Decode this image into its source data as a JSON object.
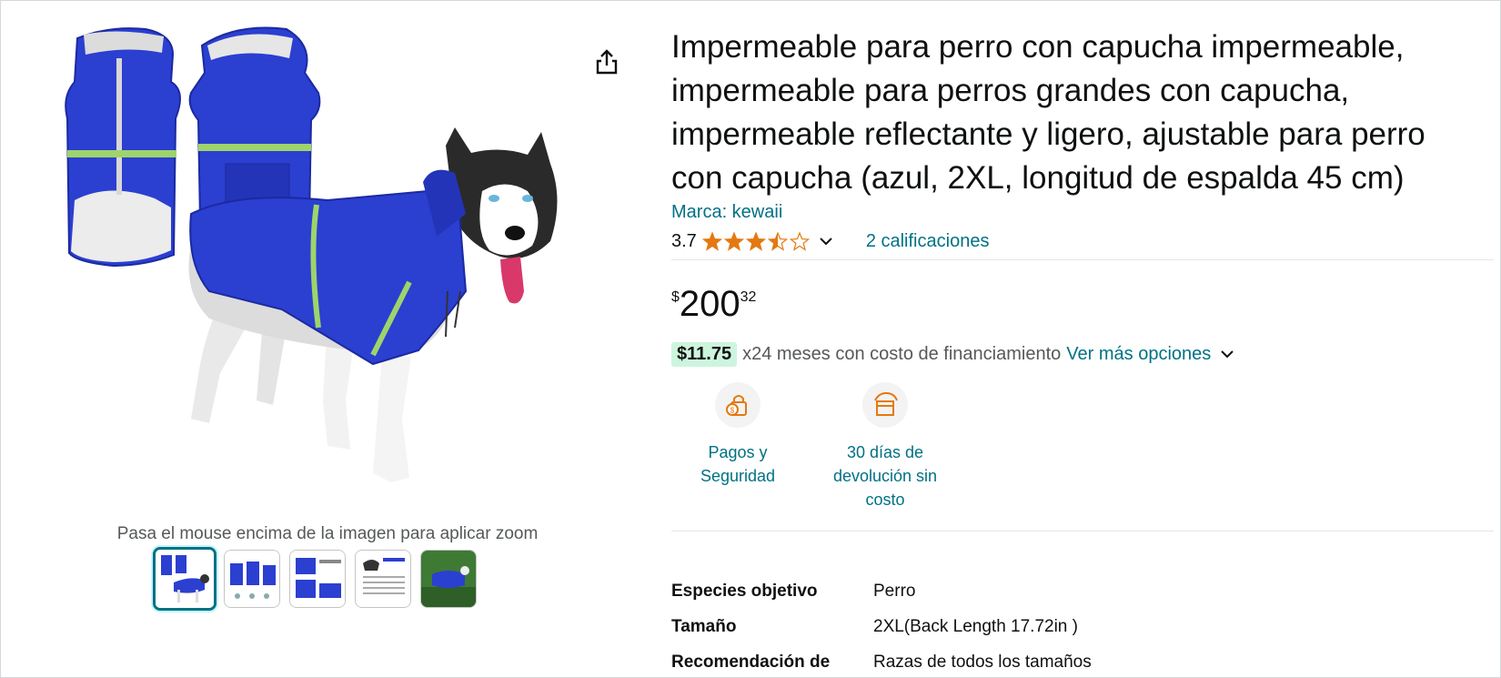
{
  "product": {
    "title": "Impermeable para perro con capucha impermeable, impermeable para perros grandes con capucha, impermeable reflectante y ligero, ajustable para perro con capucha (azul, 2XL, longitud de espalda 45 cm)",
    "brand": "Marca: kewaii",
    "rating": "3.7",
    "rating_stars": 3.5,
    "ratings_count": "2 calificaciones"
  },
  "price": {
    "symbol": "$",
    "whole": "200",
    "fraction": "32"
  },
  "financing": {
    "amount": "$11.75",
    "text": "x24 meses con costo de financiamiento",
    "link": "Ver más opciones"
  },
  "badges": [
    {
      "icon": "secure-payment-icon",
      "label": "Pagos y Seguridad"
    },
    {
      "icon": "return-box-icon",
      "label": "30 días de devolución sin costo"
    }
  ],
  "gallery": {
    "zoom_hint": "Pasa el mouse encima de la imagen para aplicar zoom",
    "thumbnail_count": 5,
    "active_thumbnail": 0
  },
  "specs": [
    {
      "key": "Especies objetivo",
      "value": "Perro"
    },
    {
      "key": "Tamaño",
      "value": "2XL(Back Length 17.72in )"
    },
    {
      "key": "Recomendación de",
      "value": "Razas de todos los tamaños"
    }
  ],
  "colors": {
    "link": "#007185",
    "star": "#e47911",
    "raincoat_blue": "#2b3fd1",
    "financing_bg": "#cdf5dd"
  }
}
